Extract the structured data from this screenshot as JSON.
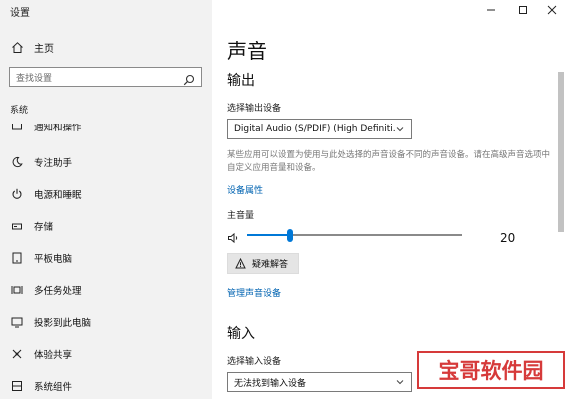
{
  "window": {
    "title": "设置",
    "controls": [
      "minimize-icon",
      "maximize-icon",
      "close-icon"
    ]
  },
  "sidebar": {
    "home_label": "主页",
    "search_placeholder": "查找设置",
    "section_header": "系统",
    "items": [
      {
        "label": "通知和操作",
        "icon": "notification-icon",
        "clipped": true
      },
      {
        "label": "专注助手",
        "icon": "moon-icon"
      },
      {
        "label": "电源和睡眠",
        "icon": "power-icon"
      },
      {
        "label": "存储",
        "icon": "storage-icon"
      },
      {
        "label": "平板电脑",
        "icon": "tablet-icon"
      },
      {
        "label": "多任务处理",
        "icon": "multitasking-icon"
      },
      {
        "label": "投影到此电脑",
        "icon": "projector-icon"
      },
      {
        "label": "体验共享",
        "icon": "shared-experience-icon"
      },
      {
        "label": "系统组件",
        "icon": "components-icon"
      }
    ]
  },
  "main": {
    "title": "声音",
    "output": {
      "heading": "输出",
      "device_label": "选择输出设备",
      "device_value": "Digital Audio (S/PDIF) (High Definiti...",
      "description": "某些应用可以设置为使用与此处选择的声音设备不同的声音设备。请在高级声音选项中自定义应用音量和设备。",
      "properties_link": "设备属性",
      "volume_label": "主音量",
      "volume_value": "20",
      "volume_fraction": 0.2,
      "troubleshoot_label": "疑难解答",
      "manage_link": "管理声音设备"
    },
    "input": {
      "heading": "输入",
      "device_label": "选择输入设备",
      "device_value": "无法找到输入设备"
    }
  },
  "watermark": {
    "text": "宝哥软件园",
    "color": "#d63a3a"
  },
  "colors": {
    "accent": "#0078d7",
    "link": "#0063b1",
    "sidebar_bg": "#f2f2f2"
  }
}
